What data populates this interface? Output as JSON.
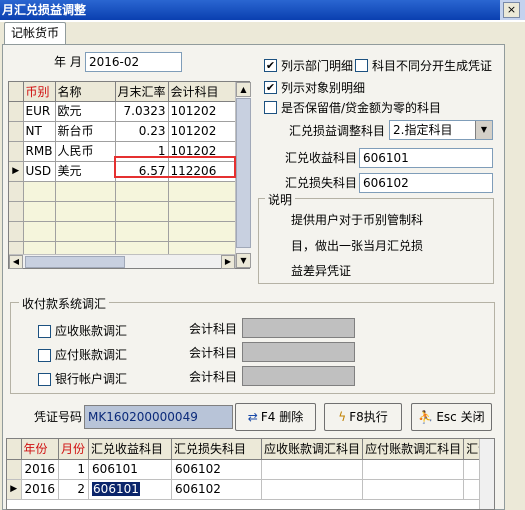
{
  "window": {
    "title": "月汇兑损益调整",
    "close_glyph": "×"
  },
  "tabs": [
    {
      "label": "记帐货币"
    }
  ],
  "period": {
    "label": "年 月",
    "value": "2016-02"
  },
  "currency_grid": {
    "headers": [
      "币别",
      "名称",
      "月末汇率",
      "会计科目"
    ],
    "rows": [
      {
        "code": "EUR",
        "name": "欧元",
        "rate": "7.0323",
        "account": "101202"
      },
      {
        "code": "NT",
        "name": "新台币",
        "rate": "0.23",
        "account": "101202"
      },
      {
        "code": "RMB",
        "name": "人民币",
        "rate": "1",
        "account": "101202"
      },
      {
        "code": "USD",
        "name": "美元",
        "rate": "6.57",
        "account": "112206"
      }
    ],
    "current_row_marker": "▶"
  },
  "options": {
    "list_dept": {
      "label": "列示部门明细",
      "checked": true
    },
    "no_diff": {
      "label": "科目不同分开生成凭证",
      "checked": false
    },
    "list_obj": {
      "label": "列示对象别明细",
      "checked": true
    },
    "zero_balance": {
      "label": "是否保留借/贷金额为零的科目",
      "checked": false
    }
  },
  "adjust_account": {
    "label": "汇兑损益调整科目",
    "value": "2.指定科目"
  },
  "gain_account": {
    "label": "汇兑收益科目",
    "value": "606101"
  },
  "loss_account": {
    "label": "汇兑损失科目",
    "value": "606102"
  },
  "explanation": {
    "title": "说明",
    "lines": [
      "提供用户对于币别管制科",
      "目，做出一张当月汇兑损",
      "益差异凭证"
    ]
  },
  "reconcile": {
    "title": "收付款系统调汇",
    "items": [
      {
        "label": "应收账款调汇",
        "account_label": "会计科目"
      },
      {
        "label": "应付账款调汇",
        "account_label": "会计科目"
      },
      {
        "label": "银行帐户调汇",
        "account_label": "会计科目"
      }
    ]
  },
  "voucher": {
    "label": "凭证号码",
    "value": "MK160200000049"
  },
  "buttons": {
    "delete": "F4 删除",
    "execute": "F8执行",
    "close": "Esc 关闭"
  },
  "result_grid": {
    "headers": [
      "年份",
      "月份",
      "汇兑收益科目",
      "汇兑损失科目",
      "应收账款调汇科目",
      "应付账款调汇科目",
      "汇调"
    ],
    "rows": [
      {
        "year": "2016",
        "month": "1",
        "gain": "606101",
        "loss": "606102"
      },
      {
        "year": "2016",
        "month": "2",
        "gain": "606101",
        "loss": "606102"
      }
    ],
    "current_row_marker": "▶"
  }
}
